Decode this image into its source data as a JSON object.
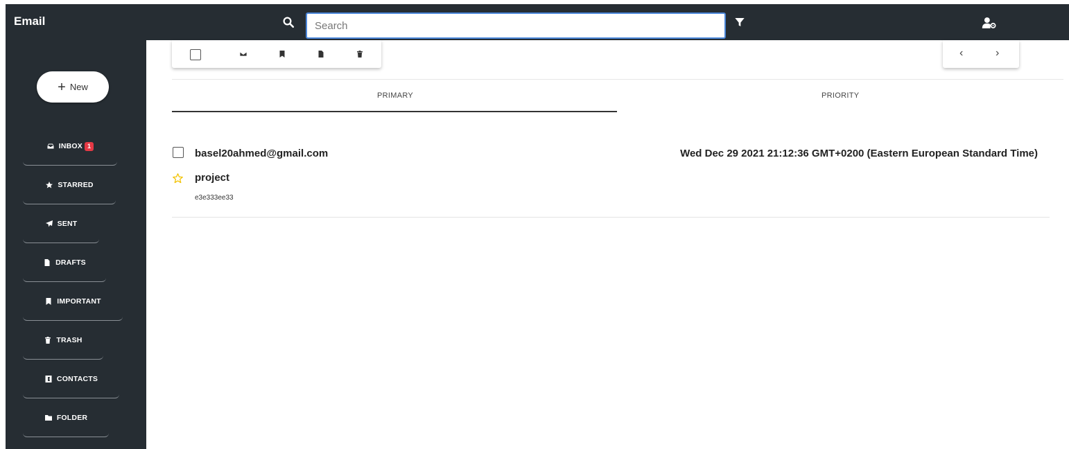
{
  "header": {
    "title": "Email",
    "search_placeholder": "Search",
    "search_value": ""
  },
  "sidebar": {
    "new_label": "New",
    "items": [
      {
        "label": "INBOX",
        "badge": "1",
        "icon": "inbox-icon"
      },
      {
        "label": "STARRED",
        "icon": "star-icon"
      },
      {
        "label": "SENT",
        "icon": "send-icon"
      },
      {
        "label": "DRAFTS",
        "icon": "file-icon"
      },
      {
        "label": "IMPORTANT",
        "icon": "bookmark-icon"
      },
      {
        "label": "TRASH",
        "icon": "trash-icon"
      },
      {
        "label": "CONTACTS",
        "icon": "contacts-icon"
      },
      {
        "label": "FOLDER",
        "icon": "folder-icon"
      }
    ]
  },
  "toolbar": {
    "icons": [
      "envelope-icon",
      "bookmark-icon",
      "file-icon",
      "trash-icon"
    ]
  },
  "pager": {
    "prev": "‹",
    "next": "›"
  },
  "tabs": [
    {
      "label": "PRIMARY",
      "active": true
    },
    {
      "label": "PRIORITY",
      "active": false
    }
  ],
  "messages": [
    {
      "sender": "basel20ahmed@gmail.com",
      "date": "Wed Dec 29 2021 21:12:36 GMT+0200 (Eastern European Standard Time)",
      "subject": "project",
      "snippet": "e3e333ee33",
      "starred": false
    }
  ],
  "colors": {
    "sidebar_bg": "#262d33",
    "search_border": "#4a86d9",
    "badge": "#e53945",
    "star": "#f2c200"
  }
}
